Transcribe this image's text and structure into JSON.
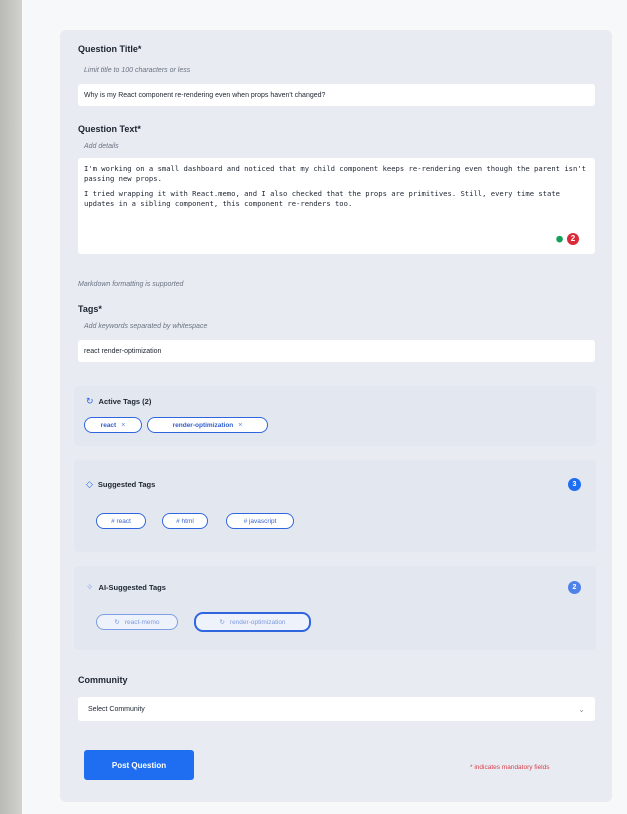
{
  "form": {
    "title_field": {
      "label": "Question Title*",
      "hint": "Limit title to 100 characters or less",
      "value": "Why is my React component re-rendering even when props haven't changed?"
    },
    "text_field": {
      "label": "Question Text*",
      "hint": "Add details",
      "paragraph_1": "I'm working on a small dashboard and noticed that my child component keeps re-rendering even though the parent isn't passing new props.",
      "paragraph_2": "I tried wrapping it with React.memo, and I also checked that the props are primitives. Still, every time state updates in a sibling component, this component re-renders too.",
      "grammar_count": "2",
      "markdown_note": "Markdown formatting is supported"
    },
    "tags_field": {
      "label": "Tags*",
      "hint": "Add keywords separated by whitespace",
      "value": "react render-optimization"
    },
    "active_tags": {
      "title": "Active Tags (2)",
      "tags": [
        {
          "label": "react",
          "remove": "×"
        },
        {
          "label": "render-optimization",
          "remove": "×"
        }
      ]
    },
    "suggested_tags": {
      "title": "Suggested Tags",
      "count": "3",
      "tags": [
        "# react",
        "# html",
        "# javascript"
      ]
    },
    "ai_tags": {
      "title": "AI-Suggested Tags",
      "count": "2",
      "tags": [
        "react-memo",
        "render-optimization"
      ]
    },
    "community": {
      "label": "Community",
      "selected": "Select Community"
    },
    "submit_label": "Post Question",
    "mandatory_note": "* indicates mandatory fields"
  },
  "colors": {
    "accent": "#1f6ef2",
    "card_bg": "#e8ecf2",
    "error": "#d9404c",
    "grammar_badge": "#d92b3a"
  }
}
